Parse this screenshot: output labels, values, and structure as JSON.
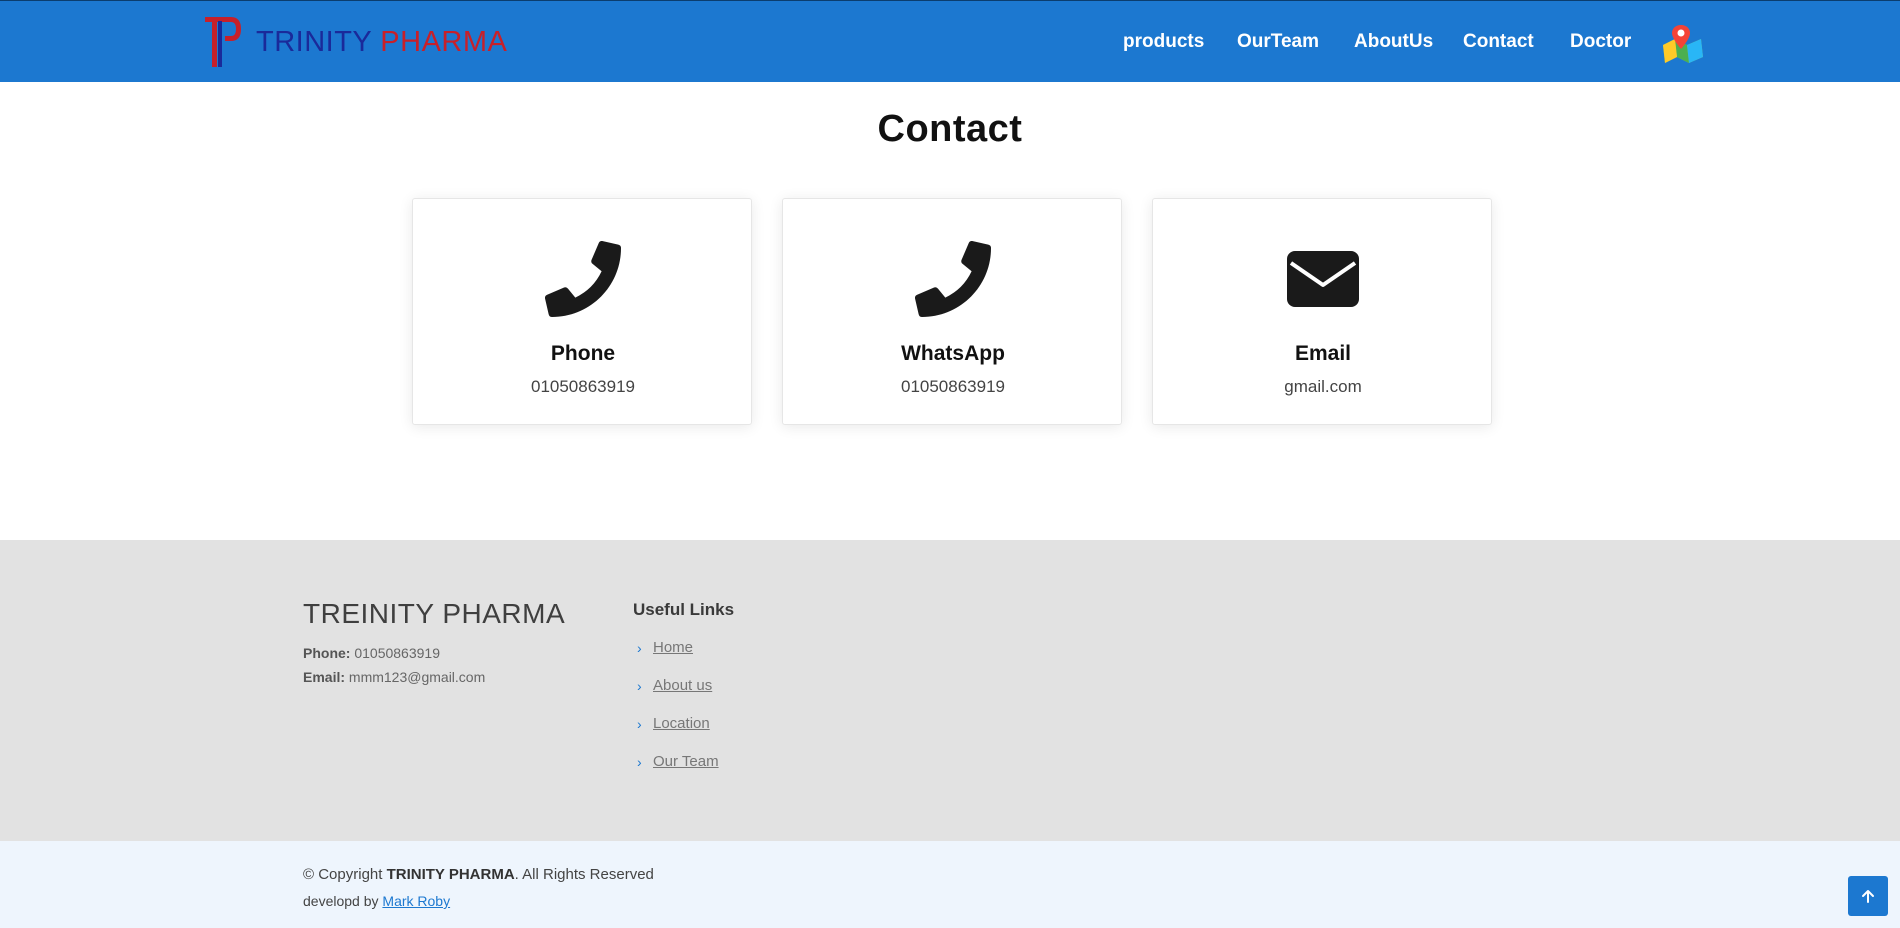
{
  "header": {
    "brand_word1": "TRINITY",
    "brand_word2": "PHARMA",
    "nav": [
      "products",
      "OurTeam",
      "AboutUs",
      "Contact",
      "Doctor"
    ],
    "map_icon": "map-pin-icon",
    "bg_color": "#1c78d0"
  },
  "contact": {
    "title": "Contact",
    "cards": [
      {
        "icon": "phone-icon",
        "title": "Phone",
        "value": "01050863919"
      },
      {
        "icon": "phone-icon",
        "title": "WhatsApp",
        "value": "01050863919"
      },
      {
        "icon": "envelope-icon",
        "title": "Email",
        "value": "gmail.com"
      }
    ]
  },
  "footer": {
    "brand": "TREINITY PHARMA",
    "phone_label": "Phone:",
    "phone": "01050863919",
    "email_label": "Email:",
    "email": "mmm123@gmail.com",
    "links_title": "Useful Links",
    "links": [
      "Home",
      "About us",
      "Location",
      "Our Team"
    ]
  },
  "bottom": {
    "copyright_prefix": "© Copyright",
    "copyright_brand": "TRINITY PHARMA",
    "copyright_suffix": ". All Rights Reserved",
    "dev_prefix": "developd by",
    "dev_name": "Mark Roby",
    "back_to_top_icon": "arrow-up-icon"
  }
}
